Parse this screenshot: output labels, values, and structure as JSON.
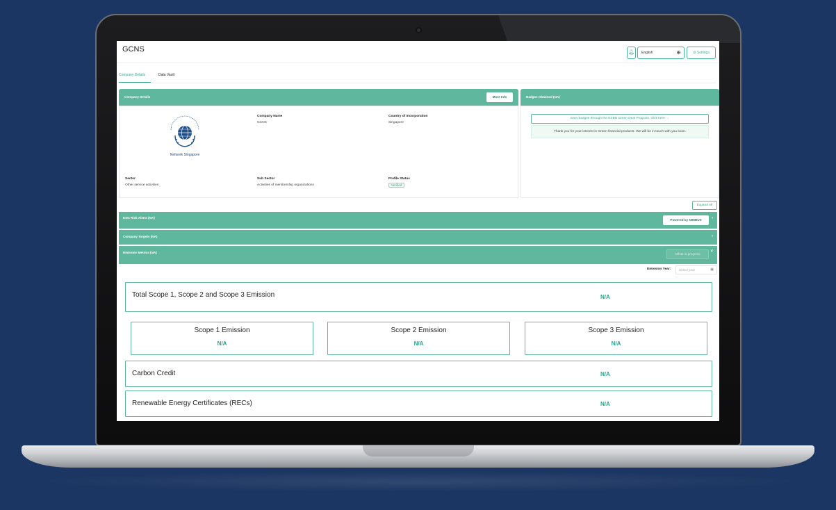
{
  "app": {
    "title": "GCNS",
    "language": "English",
    "settings_label": "Settings"
  },
  "tabs": [
    {
      "label": "Company Details",
      "active": true
    },
    {
      "label": "Data Vault",
      "active": false
    }
  ],
  "company_details": {
    "header": "Company Details",
    "more_info_label": "More Info",
    "logo_caption": "Network Singapore",
    "company_name_label": "Company Name",
    "company_name": "GCNS",
    "country_label": "Country of Incorporation",
    "country": "Singapore",
    "sector_label": "Sector",
    "sector": "Other service activities",
    "sub_sector_label": "Sub Sector",
    "sub_sector": "Activities of membership organizations",
    "profile_status_label": "Profile Status",
    "profile_status": "Verified"
  },
  "badges": {
    "header": "Badges Obtained (NA)",
    "earn_button": "Earn badges through the ESBN Green Deal Program, click here →",
    "thanks_text": "Thank you for your interest in Green financial products. We will be in touch with you soon."
  },
  "expand_all_label": "Expand All",
  "sections": {
    "esg": {
      "label": "ESG Risk Alerts (NA)",
      "button": "Powered by NIMBUS"
    },
    "targets": {
      "label": "Company Targets (NA)"
    },
    "emission": {
      "label": "Emission Metrics (NA)",
      "button": "Offset in progress"
    }
  },
  "emission_year": {
    "label": "Emission Year:",
    "placeholder": "Select year"
  },
  "metrics": {
    "total": {
      "title": "Total Scope 1, Scope 2 and Scope 3 Emission",
      "value": "N/A"
    },
    "scope1": {
      "title": "Scope 1 Emission",
      "value": "N/A"
    },
    "scope2": {
      "title": "Scope 2 Emission",
      "value": "N/A"
    },
    "scope3": {
      "title": "Scope 3 Emission",
      "value": "N/A"
    },
    "carbon_credit": {
      "title": "Carbon Credit",
      "value": "N/A"
    },
    "recs": {
      "title": "Renewable Energy Certificates (RECs)",
      "value": "N/A"
    }
  },
  "colors": {
    "background": "#1b3662",
    "accent": "#5fb89e",
    "value_green": "#2ea38b"
  }
}
